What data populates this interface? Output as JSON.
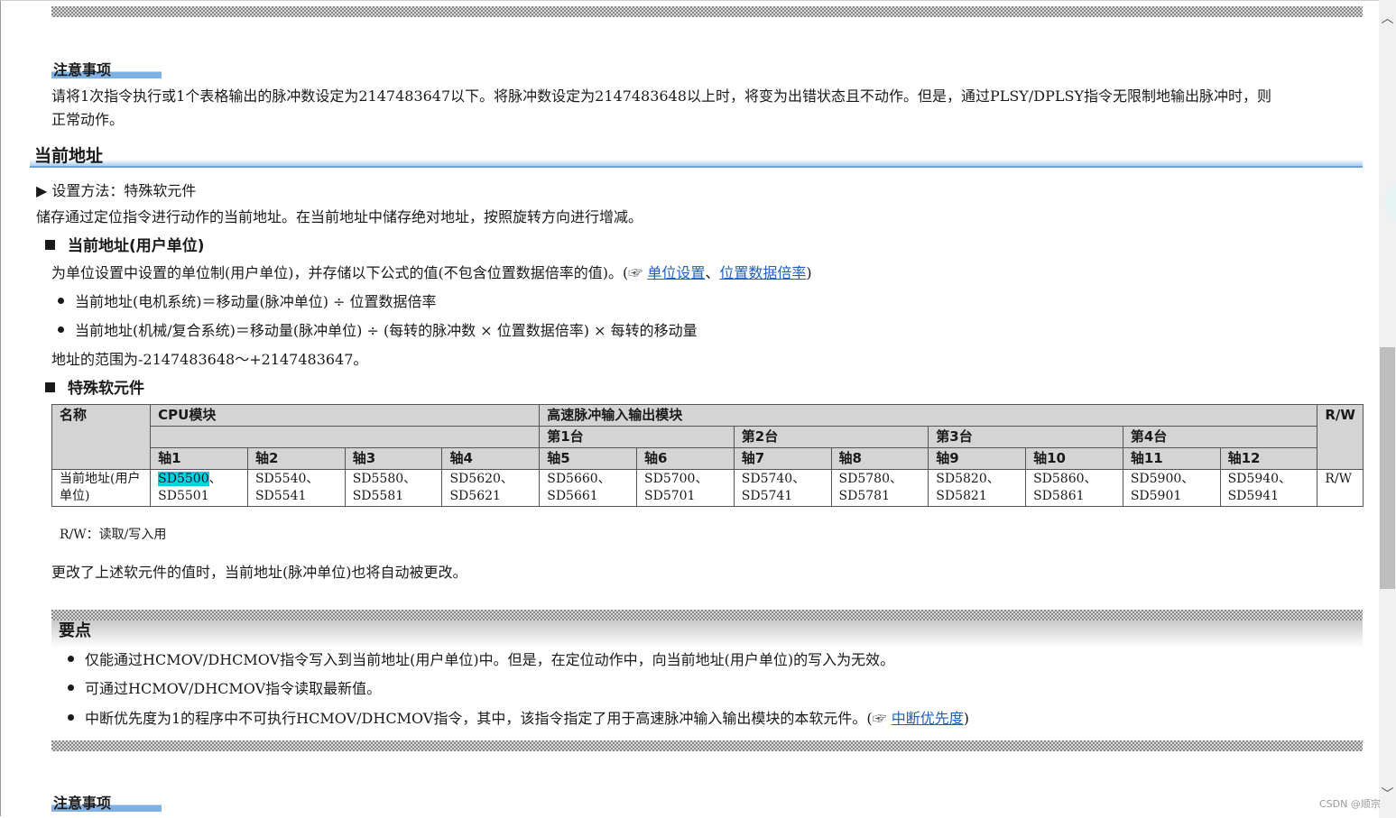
{
  "caution1": {
    "title": "注意事项",
    "line1": "请将1次指令执行或1个表格输出的脉冲数设定为2147483647以下。将脉冲数设定为2147483648以上时，将变为出错状态且不动作。但是，通过PLSY/DPLSY指令无限制地输出脉冲时，则",
    "line2": "正常动作。"
  },
  "section": {
    "heading": "当前地址",
    "setting_method": "▶ 设置方法：特殊软元件",
    "description": "储存通过定位指令进行动作的当前地址。在当前地址中储存绝对地址，按照旋转方向进行增减。"
  },
  "user_unit": {
    "heading": "当前地址(用户单位)",
    "desc": "为单位设置中设置的单位制(用户单位)，并存储以下公式的值(不包含位置数据倍率的值)。(",
    "ref_icon": "☞",
    "link1": "单位设置",
    "sep": "、",
    "link2": "位置数据倍率",
    "close": ")",
    "bullets": [
      "当前地址(电机系统)＝移动量(脉冲单位) ÷ 位置数据倍率",
      "当前地址(机械/复合系统)＝移动量(脉冲单位) ÷ (每转的脉冲数 × 位置数据倍率) × 每转的移动量"
    ],
    "range": "地址的范围为-2147483648～+2147483647。"
  },
  "special_device": {
    "heading": "特殊软元件",
    "table": {
      "col_name": "名称",
      "col_cpu": "CPU模块",
      "col_hs": "高速脉冲输入输出模块",
      "col_rw": "R/W",
      "units": [
        "第1台",
        "第2台",
        "第3台",
        "第4台"
      ],
      "axes": [
        "轴1",
        "轴2",
        "轴3",
        "轴4",
        "轴5",
        "轴6",
        "轴7",
        "轴8",
        "轴9",
        "轴10",
        "轴11",
        "轴12"
      ],
      "row_name": "当前地址(用户单位)",
      "cells": [
        [
          "SD5500",
          "、",
          "SD5501"
        ],
        [
          "SD5540、",
          "",
          "SD5541"
        ],
        [
          "SD5580、",
          "",
          "SD5581"
        ],
        [
          "SD5620、",
          "",
          "SD5621"
        ],
        [
          "SD5660、",
          "",
          "SD5661"
        ],
        [
          "SD5700、",
          "",
          "SD5701"
        ],
        [
          "SD5740、",
          "",
          "SD5741"
        ],
        [
          "SD5780、",
          "",
          "SD5781"
        ],
        [
          "SD5820、",
          "",
          "SD5821"
        ],
        [
          "SD5860、",
          "",
          "SD5861"
        ],
        [
          "SD5900、",
          "",
          "SD5901"
        ],
        [
          "SD5940、",
          "",
          "SD5941"
        ]
      ],
      "row_rw": "R/W"
    },
    "rw_note": "R/W：读取/写入用",
    "change_note": "更改了上述软元件的值时，当前地址(脉冲单位)也将自动被更改。"
  },
  "point": {
    "title": "要点",
    "bullets": [
      "仅能通过HCMOV/DHCMOV指令写入到当前地址(用户单位)中。但是，在定位动作中，向当前地址(用户单位)的写入为无效。",
      "可通过HCMOV/DHCMOV指令读取最新值。",
      "中断优先度为1的程序中不可执行HCMOV/DHCMOV指令，其中，该指令指定了用于高速脉冲输入输出模块的本软元件。("
    ],
    "ref_icon": "☞",
    "link": "中断优先度",
    "close": ")"
  },
  "caution2": {
    "title": "注意事项"
  },
  "watermark": "CSDN @顺宗",
  "scroll_up_glyph": "︿",
  "scroll_down_glyph": "﹀"
}
